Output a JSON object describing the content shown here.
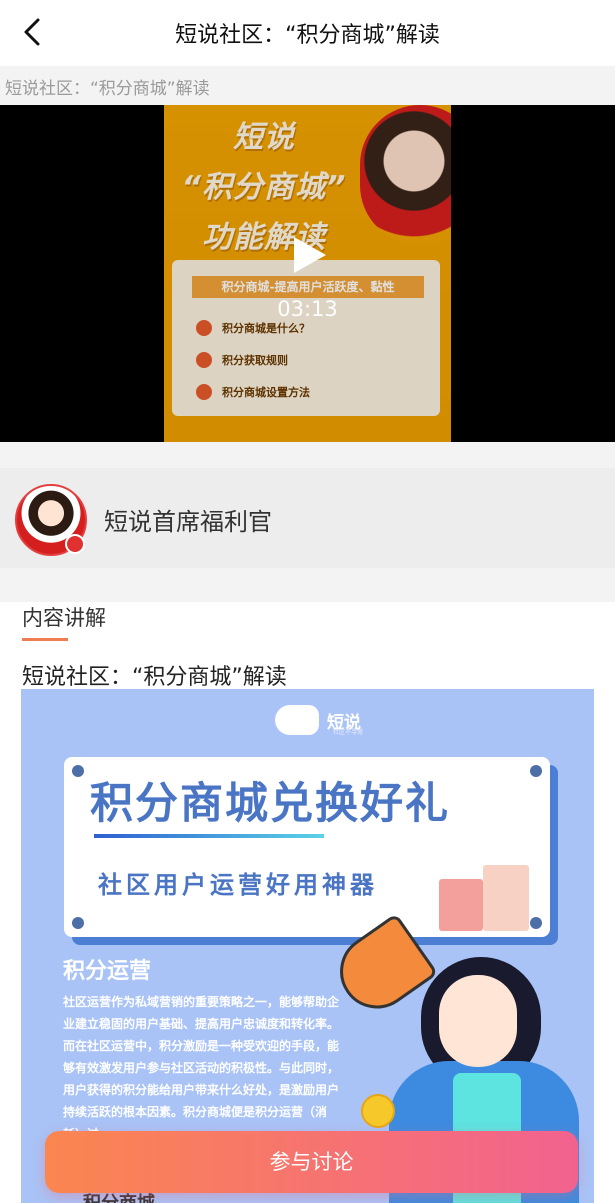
{
  "header": {
    "title": "短说社区：“积分商城”解读",
    "back_icon": "chevron-left-icon"
  },
  "subtitle": "短说社区：“积分商城”解读",
  "video": {
    "duration": "03:13",
    "play_icon": "play-icon",
    "poster": {
      "headline_1": "短说",
      "headline_2": "“积分商城”",
      "headline_3": "功能解读",
      "bar_text": "积分商城-提高用户活跃度、黏性",
      "items": [
        "积分商城是什么？",
        "积分获取规则",
        "积分商城设置方法"
      ]
    }
  },
  "author": {
    "name": "短说首席福利官"
  },
  "content": {
    "tab_label": "内容讲解",
    "article_title": "短说社区：“积分商城”解读",
    "banner": {
      "brand_name": "短说",
      "brand_sub": "社区不寻常",
      "headline": "积分商城兑换好礼",
      "subheadline": "社区用户运营好用神器",
      "section_title": "积分运营",
      "section_body": "社区运营作为私域营销的重要策略之一，能够帮助企业建立稳固的用户基础、提高用户忠诚度和转化率。而在社区运营中，积分激励是一种受欢迎的手段，能够有效激发用户参与社区活动的积极性。与此同时，用户获得的积分能给用户带来什么好处，是激励用户持续活跃的根本因素。积分商城便是积分运营（消耗）过",
      "section_foot": "积分商城"
    }
  },
  "cta": {
    "label": "参与讨论"
  }
}
